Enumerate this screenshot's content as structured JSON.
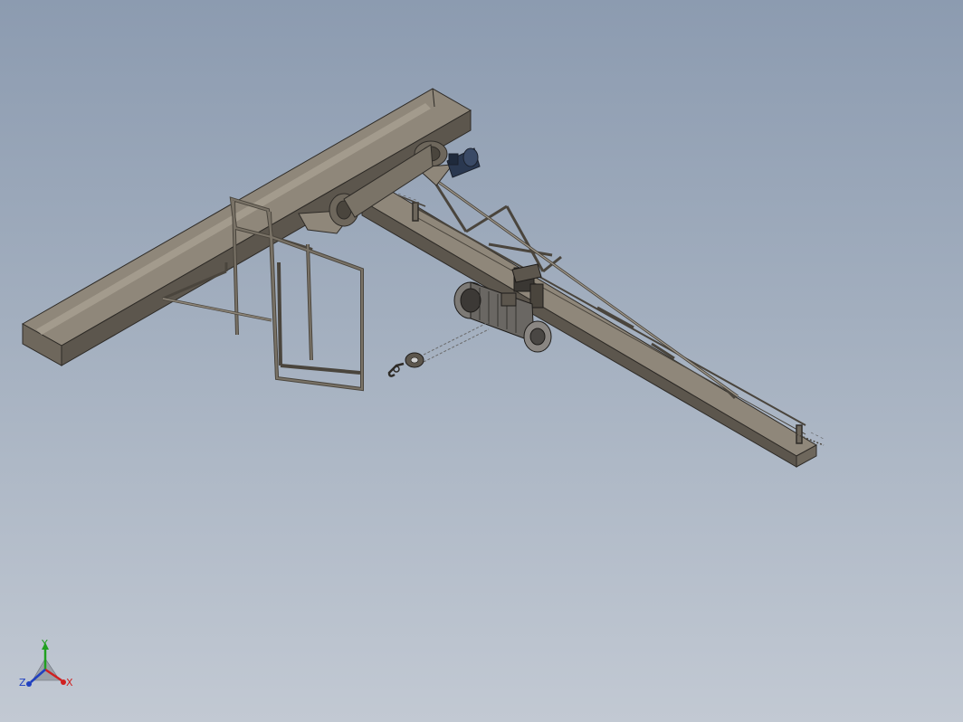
{
  "viewport": {
    "model": "jib-crane-assembly",
    "triad": {
      "x_label": "X",
      "y_label": "Y",
      "z_label": "Z",
      "x_color": "#d02020",
      "y_color": "#20a020",
      "z_color": "#2040c0"
    },
    "colors": {
      "steel_top": "#8f877a",
      "steel_side": "#6e675c",
      "steel_dark": "#4a453d",
      "edge": "#2e2b27",
      "motor_blue": "#2a3850",
      "hoist": "#7d7a76"
    }
  }
}
